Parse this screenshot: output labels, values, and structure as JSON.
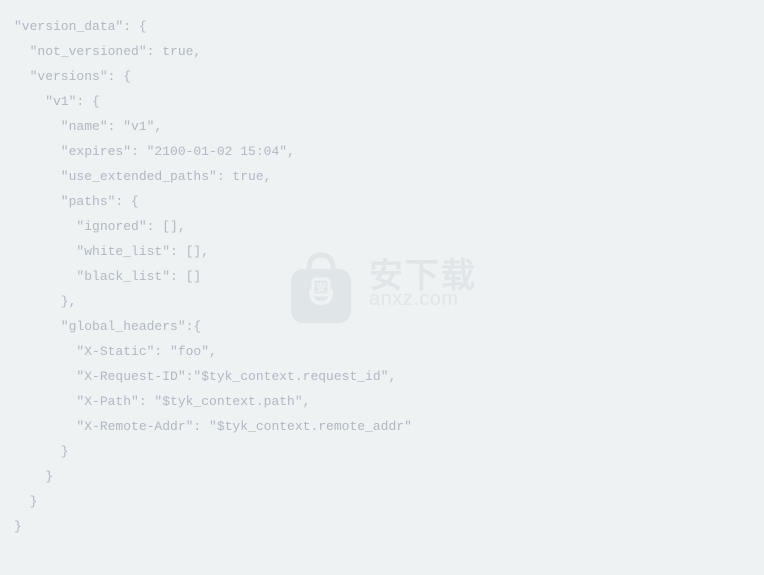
{
  "code": {
    "lines": [
      "\"version_data\": {",
      "  \"not_versioned\": true,",
      "  \"versions\": {",
      "    \"v1\": {",
      "      \"name\": \"v1\",",
      "      \"expires\": \"2100-01-02 15:04\",",
      "      \"use_extended_paths\": true,",
      "      \"paths\": {",
      "        \"ignored\": [],",
      "        \"white_list\": [],",
      "        \"black_list\": []",
      "      },",
      "      \"global_headers\":{",
      "        \"X-Static\": \"foo\",",
      "        \"X-Request-ID\":\"$tyk_context.request_id\",",
      "        \"X-Path\": \"$tyk_context.path\",",
      "        \"X-Remote-Addr\": \"$tyk_context.remote_addr\"",
      "      }",
      "    }",
      "  }",
      "}"
    ]
  },
  "watermark": {
    "cn": "安下载",
    "en": "anxz.com"
  }
}
